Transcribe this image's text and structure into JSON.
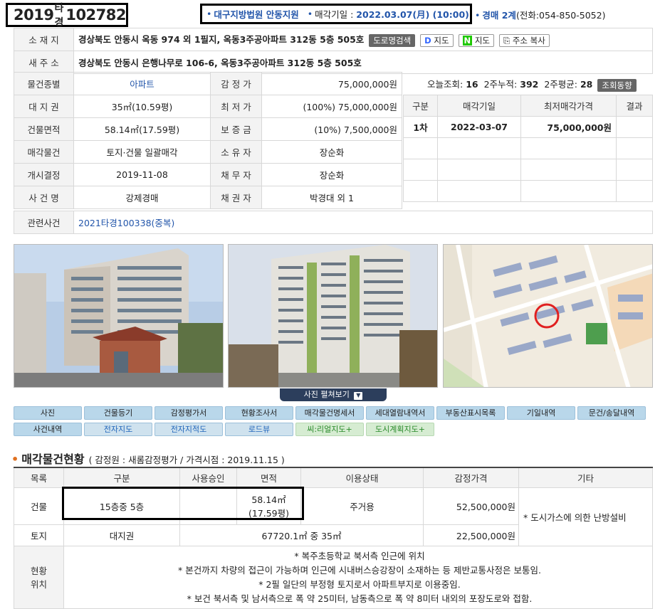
{
  "header": {
    "case_year": "2019",
    "case_type": "타경",
    "case_number": "102782",
    "court": "대구지방법원 안동지원",
    "sale_date_label": "매각기일 :",
    "sale_date": "2022.03.07(月) (10:00)",
    "department": "경매 2계",
    "phone": "(전화:054-850-5052)"
  },
  "info": {
    "location_label": "소 재 지",
    "location": "경상북도 안동시 옥동 974 외 1필지, 옥동3주공아파트 312동 5층 505호",
    "road_search_btn": "도로명검색",
    "map_btn_daum": "지도",
    "map_btn_naver": "지도",
    "copy_btn": "주소 복사",
    "new_address_label": "새 주 소",
    "new_address": "경상북도 안동시 은행나무로 106-6, 옥동3주공아파트 312동 5층 505호",
    "type_label": "물건종별",
    "type": "아파트",
    "appraisal_label": "감 정 가",
    "appraisal": "75,000,000원",
    "land_label": "대 지 권",
    "land": "35㎡(10.59평)",
    "min_price_label": "최 저 가",
    "min_price": "(100%) 75,000,000원",
    "building_label": "건물면적",
    "building": "58.14㎡(17.59평)",
    "deposit_label": "보 증 금",
    "deposit": "(10%) 7,500,000원",
    "sale_item_label": "매각물건",
    "sale_item": "토지·건물 일괄매각",
    "owner_label": "소 유 자",
    "owner": "장순화",
    "start_label": "개시결정",
    "start": "2019-11-08",
    "debtor_label": "채 무 자",
    "debtor": "장순화",
    "case_name_label": "사 건 명",
    "case_name": "강제경매",
    "creditor_label": "채 권 자",
    "creditor": "박경대 외 1",
    "related_label": "관련사건",
    "related": "2021타경100338(중복)"
  },
  "views": {
    "today_label": "오늘조회:",
    "today": "16",
    "two_week_label": "2주누적:",
    "two_week": "392",
    "avg_label": "2주평균:",
    "avg": "28",
    "trend_btn": "조회동향"
  },
  "schedule": {
    "headers": [
      "구분",
      "매각기일",
      "최저매각가격",
      "결과"
    ],
    "rows": [
      [
        "1차",
        "2022-03-07",
        "75,000,000원",
        ""
      ]
    ]
  },
  "photo_toggle": "사진 펼쳐보기",
  "buttons_row1": [
    "사진",
    "건물등기",
    "감정평가서",
    "현황조사서",
    "매각물건명세서",
    "세대열람내역서",
    "부동산표시목록",
    "기일내역",
    "문건/송달내역"
  ],
  "buttons_row2": [
    "사건내역",
    "전자지도",
    "전자지적도",
    "로드뷰",
    "씨:리얼지도+",
    "도시계획지도+"
  ],
  "section": {
    "title": "매각물건현황",
    "subtitle": "( 감정원 : 새롬감정평가 / 가격시점 : 2019.11.15 )"
  },
  "goods": {
    "headers": [
      "목록",
      "구분",
      "사용승인",
      "면적",
      "이용상태",
      "감정가격",
      "기타"
    ],
    "building_row": {
      "list": "건물",
      "kind": "15층중 5층",
      "approval": "",
      "area1": "58.14㎡",
      "area2": "(17.59평)",
      "use": "주거용",
      "price": "52,500,000원"
    },
    "etc": "* 도시가스에 의한 난방설비",
    "land_row": {
      "list": "토지",
      "kind": "대지권",
      "area": "67720.1㎡ 중 35㎡",
      "price": "22,500,000원"
    },
    "status_label1": "현황",
    "status_label2": "위치",
    "notes": [
      "* 복주초등학교 북서측 인근에 위치",
      "* 본건까지 차량의 접근이 가능하며 인근에 시내버스승강장이 소재하는 등 제반교통사정은 보통임.",
      "* 2필 일단의 부정형 토지로서 아파트부지로 이용중임.",
      "* 보건 북서측 및 남서측으로 폭 약 25미터, 남동측으로 폭 약 8미터 내외의 포장도로와 접함."
    ]
  }
}
